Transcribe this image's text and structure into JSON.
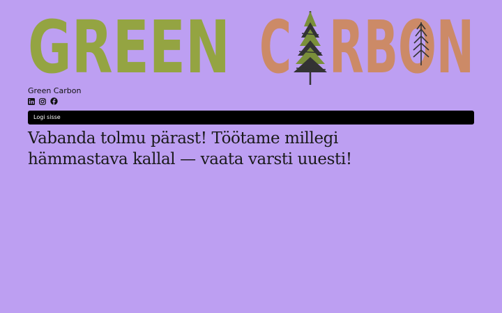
{
  "brand": {
    "logo_word1": "GREEN",
    "logo_word2_part1": "C",
    "logo_word2_part2": "RBON",
    "name": "Green Carbon",
    "colors": {
      "background": "#bd9ff2",
      "green": "#94a442",
      "orange": "#cc8a67",
      "tree_dark": "#333333"
    }
  },
  "social": [
    {
      "icon": "linkedin-icon"
    },
    {
      "icon": "instagram-icon"
    },
    {
      "icon": "facebook-icon"
    }
  ],
  "login": {
    "label": "Logi sisse"
  },
  "main": {
    "headline": "Vabanda tolmu pärast! Töötame millegi hämmastava kallal — vaata varsti uuesti!"
  }
}
